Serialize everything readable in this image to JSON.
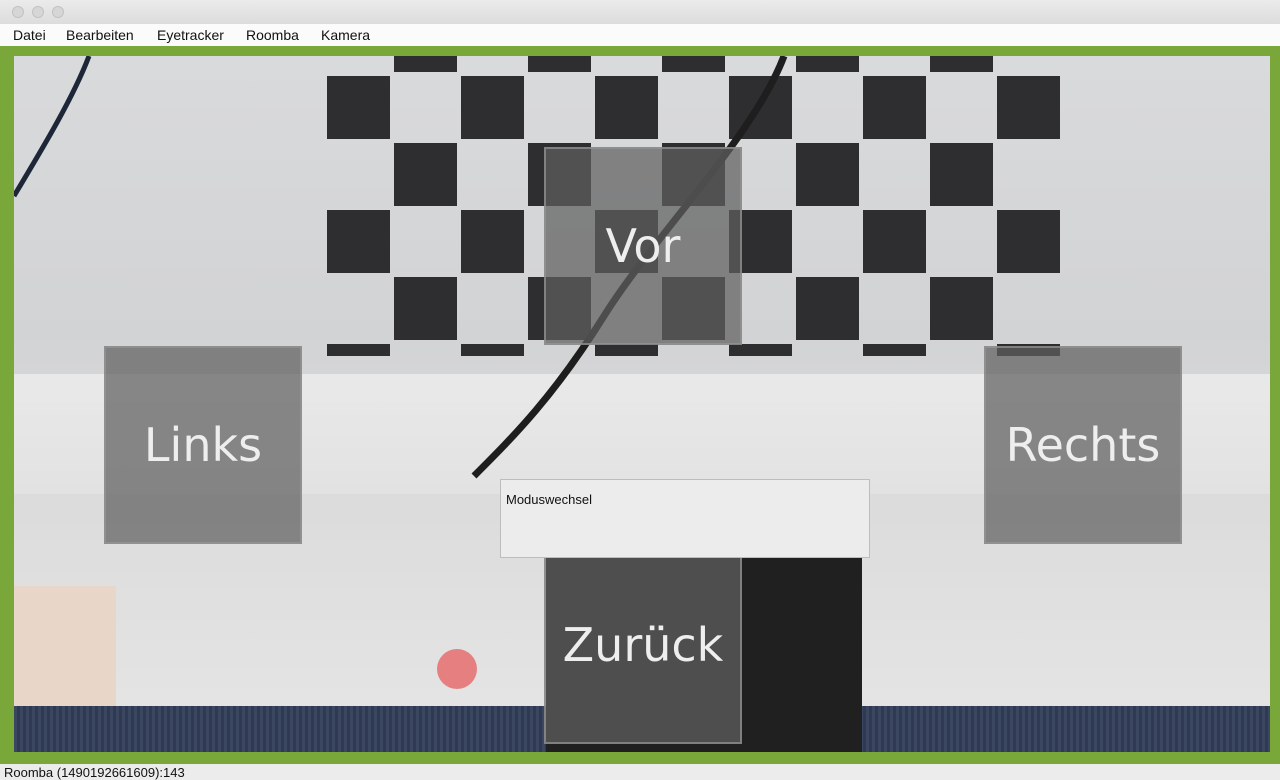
{
  "window": {
    "traffic_lights": [
      "close-button",
      "minimize-button",
      "zoom-button"
    ]
  },
  "menubar": {
    "items": [
      "Datei",
      "Bearbeiten",
      "Eyetracker",
      "Roomba",
      "Kamera"
    ]
  },
  "controls": {
    "forward_label": "Vor",
    "left_label": "Links",
    "right_label": "Rechts",
    "back_label": "Zurück"
  },
  "mode_panel": {
    "label": "Moduswechsel"
  },
  "status": {
    "text": "Roomba (1490192661609):143"
  },
  "colors": {
    "border_accent": "#7aa73a",
    "gaze_marker": "#e66e6e",
    "button_fill": "#5f5f5f"
  }
}
